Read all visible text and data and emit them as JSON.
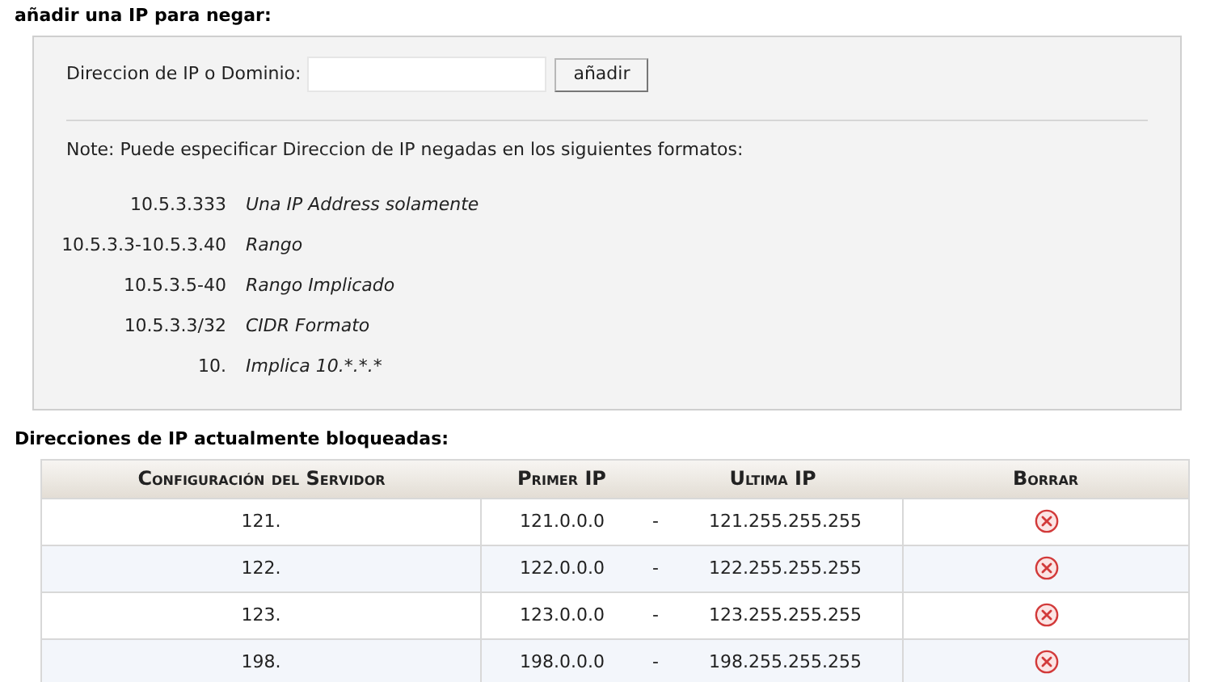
{
  "add_section": {
    "title": "añadir una IP para negar:",
    "field_label": "Direccion de IP o Dominio:",
    "add_button": "añadir",
    "note": "Note: Puede especificar Direccion de IP negadas en los siguientes formatos:",
    "formats": [
      {
        "example": "10.5.3.333",
        "description": "Una IP Address solamente"
      },
      {
        "example": "10.5.3.3-10.5.3.40",
        "description": "Rango"
      },
      {
        "example": "10.5.3.5-40",
        "description": "Rango Implicado"
      },
      {
        "example": "10.5.3.3/32",
        "description": "CIDR Formato"
      },
      {
        "example": "10.",
        "description": "Implica 10.*.*.*"
      }
    ]
  },
  "blocked_section": {
    "title": "Direcciones de IP actualmente bloqueadas:",
    "table": {
      "columns": [
        "Configuración del Servidor",
        "Primer IP",
        "Ultima IP",
        "Borrar"
      ],
      "rows": [
        {
          "server_config": "121.",
          "first_ip": "121.0.0.0",
          "separator": "-",
          "last_ip": "121.255.255.255"
        },
        {
          "server_config": "122.",
          "first_ip": "122.0.0.0",
          "separator": "-",
          "last_ip": "122.255.255.255"
        },
        {
          "server_config": "123.",
          "first_ip": "123.0.0.0",
          "separator": "-",
          "last_ip": "123.255.255.255"
        },
        {
          "server_config": "198.",
          "first_ip": "198.0.0.0",
          "separator": "-",
          "last_ip": "198.255.255.255"
        }
      ]
    }
  }
}
